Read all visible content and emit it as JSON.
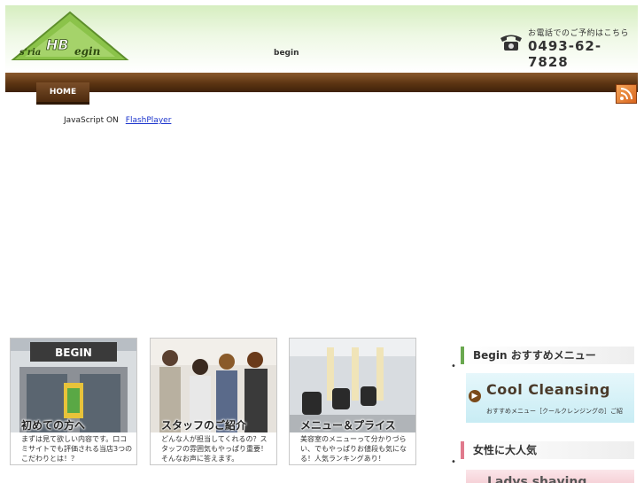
{
  "header": {
    "logo_text": "s'ria HB egin",
    "site_name": "begin",
    "phone_caption": "お電話でのご予約はこちら",
    "phone_number": "0493-62-7828"
  },
  "nav": {
    "home_label": "HOME"
  },
  "notice": {
    "text": "JavaScript ON",
    "link": "FlashPlayer"
  },
  "cards": [
    {
      "title": "初めての方へ",
      "text": "まずは見て欲しい内容です。口コミサイトでも評価される当店3つのこだわりとは！？",
      "photo_sign": "BEGIN"
    },
    {
      "title": "スタッフのご紹介",
      "text": "どんな人が担当してくれるの？スタッフの雰囲気もやっぱり重要！そんなお声に答えます。"
    },
    {
      "title": "メニュー＆プライス",
      "text": "美容室のメニューって分かりづらい、でもやっぱりお値段も気になる！人気ランキングあり！"
    }
  ],
  "sidebar": {
    "recommend_heading": "Begin おすすめメニュー",
    "cool_title": "Cool Cleansing",
    "cool_sub": "おすすめメニュー［クールクレンジングの］ご紹",
    "popular_heading": "女性に大人気",
    "ladys_title": "Ladys shaving"
  },
  "colors": {
    "nav_brown": "#5c3412",
    "logo_green": "#6aa84f",
    "link_blue": "#1a33cc"
  }
}
